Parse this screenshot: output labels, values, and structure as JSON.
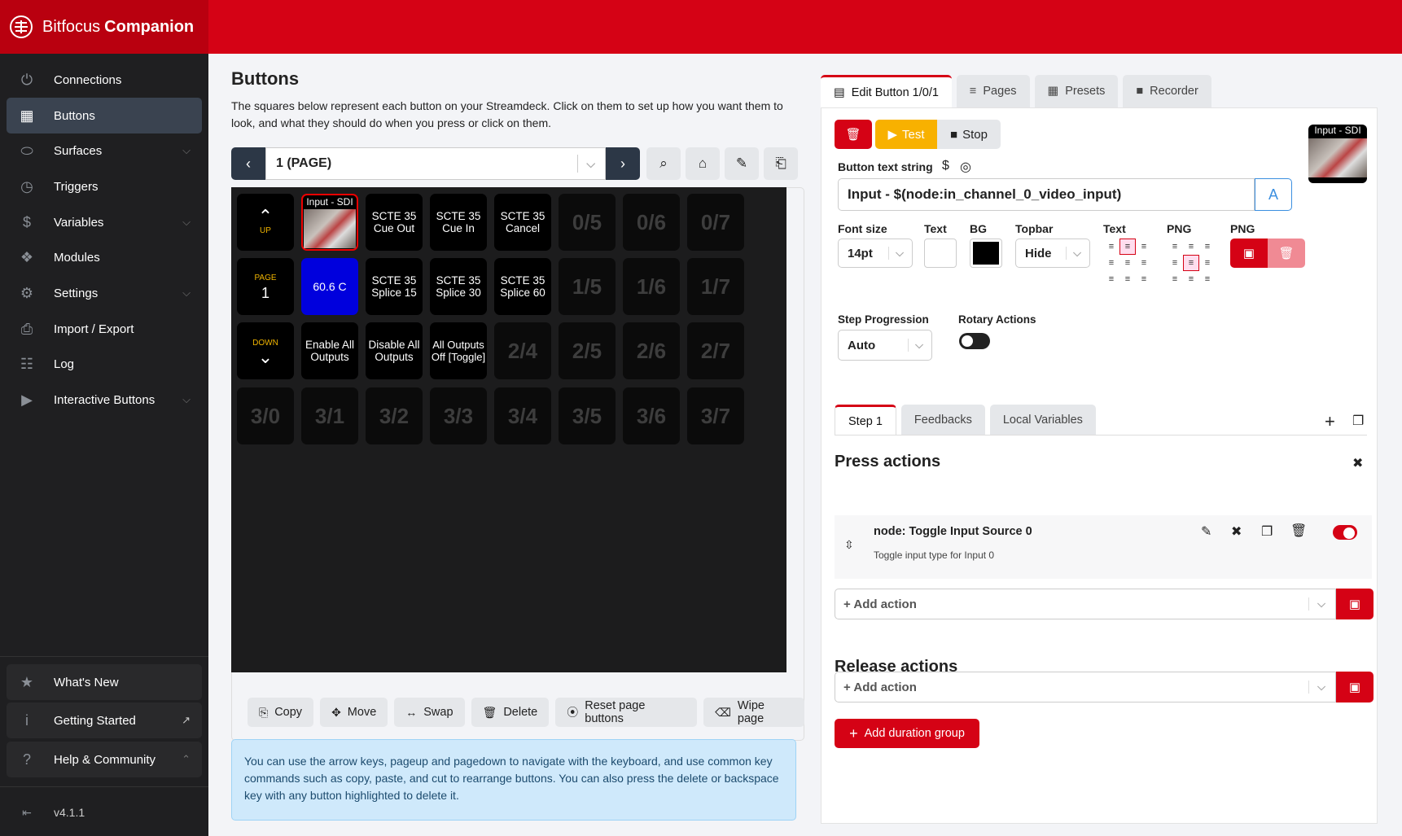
{
  "app": {
    "brand_prefix": "Bitfocus",
    "brand_name": "Companion",
    "version": "v4.1.1"
  },
  "sidebar": {
    "items": [
      {
        "label": "Connections",
        "icon": "plug-icon"
      },
      {
        "label": "Buttons",
        "icon": "grid-icon",
        "active": true
      },
      {
        "label": "Surfaces",
        "icon": "gamepad-icon",
        "expandable": true
      },
      {
        "label": "Triggers",
        "icon": "clock-icon"
      },
      {
        "label": "Variables",
        "icon": "dollar-icon",
        "expandable": true
      },
      {
        "label": "Modules",
        "icon": "puzzle-icon"
      },
      {
        "label": "Settings",
        "icon": "gear-icon",
        "expandable": true
      },
      {
        "label": "Import / Export",
        "icon": "file-import-icon"
      },
      {
        "label": "Log",
        "icon": "clipboard-icon"
      },
      {
        "label": "Interactive Buttons",
        "icon": "play-square-icon",
        "expandable": true
      }
    ],
    "bottom": [
      {
        "label": "What's New",
        "icon": "star-icon"
      },
      {
        "label": "Getting Started",
        "icon": "info-icon"
      },
      {
        "label": "Help & Community",
        "icon": "question-circle-icon"
      }
    ]
  },
  "main": {
    "title": "Buttons",
    "description": "The squares below represent each button on your Streamdeck. Click on them to set up how you want them to look, and what they should do when you press or click on them.",
    "page_select": "1 (PAGE)",
    "grid": [
      [
        {
          "type": "nav",
          "label": "UP",
          "glyph": "^"
        },
        {
          "type": "image",
          "label": "Input - SDI",
          "selected": true
        },
        {
          "text": "SCTE 35 Cue Out"
        },
        {
          "text": "SCTE 35 Cue In"
        },
        {
          "text": "SCTE 35 Cancel"
        },
        {
          "empty": "0/5"
        },
        {
          "empty": "0/6"
        },
        {
          "empty": "0/7"
        }
      ],
      [
        {
          "type": "page",
          "label": "PAGE",
          "value": "1"
        },
        {
          "text": "60.6 C",
          "blue": true
        },
        {
          "text": "SCTE 35 Splice 15"
        },
        {
          "text": "SCTE 35 Splice 30"
        },
        {
          "text": "SCTE 35 Splice 60"
        },
        {
          "empty": "1/5"
        },
        {
          "empty": "1/6"
        },
        {
          "empty": "1/7"
        }
      ],
      [
        {
          "type": "nav",
          "label": "DOWN",
          "glyph": "v"
        },
        {
          "text": "Enable All Outputs"
        },
        {
          "text": "Disable All Outputs"
        },
        {
          "text": "All Outputs Off [Toggle]"
        },
        {
          "empty": "2/4"
        },
        {
          "empty": "2/5"
        },
        {
          "empty": "2/6"
        },
        {
          "empty": "2/7"
        }
      ],
      [
        {
          "empty": "3/0"
        },
        {
          "empty": "3/1"
        },
        {
          "empty": "3/2"
        },
        {
          "empty": "3/3"
        },
        {
          "empty": "3/4"
        },
        {
          "empty": "3/5"
        },
        {
          "empty": "3/6"
        },
        {
          "empty": "3/7"
        }
      ]
    ],
    "actions": [
      "Copy",
      "Move",
      "Swap",
      "Delete",
      "Reset page buttons",
      "Wipe page"
    ],
    "info": "You can use the arrow keys, pageup and pagedown to navigate with the keyboard, and use common key commands such as copy, paste, and cut to rearrange buttons. You can also press the delete or backspace key with any button highlighted to delete it."
  },
  "editor": {
    "tabs": [
      "Edit Button 1/0/1",
      "Pages",
      "Presets",
      "Recorder"
    ],
    "test_label": "Test",
    "stop_label": "Stop",
    "preview_label": "Input - SDI",
    "text_string_label": "Button text string",
    "text_string_value": "Input - $(node:in_channel_0_video_input)",
    "font_size_label": "Font size",
    "font_size_value": "14pt",
    "text_color_label": "Text",
    "bg_label": "BG",
    "topbar_label": "Topbar",
    "topbar_value": "Hide",
    "text_align_label": "Text",
    "png_align_label": "PNG",
    "png_label": "PNG",
    "step_progression_label": "Step Progression",
    "step_progression_value": "Auto",
    "rotary_actions_label": "Rotary Actions",
    "subtabs": [
      "Step 1",
      "Feedbacks",
      "Local Variables"
    ],
    "press_actions_title": "Press actions",
    "action_name": "node: Toggle Input Source 0",
    "action_desc": "Toggle input type for Input 0",
    "add_action_placeholder": "+ Add action",
    "release_actions_title": "Release actions",
    "add_duration_group": "Add duration group",
    "colors": {
      "text": "#ffffff",
      "bg": "#000000",
      "accent": "#d50215",
      "test": "#f8b100"
    }
  }
}
